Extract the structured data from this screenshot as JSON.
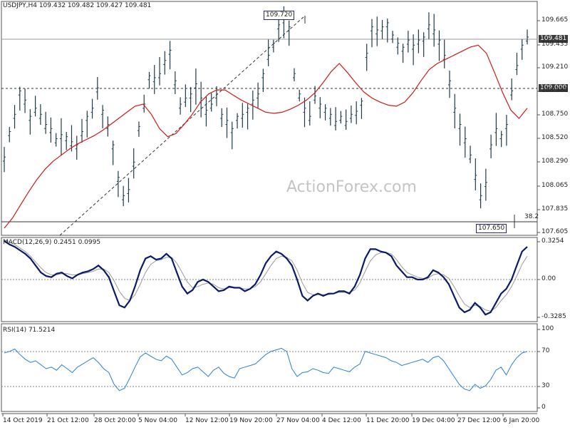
{
  "chart_data": [
    {
      "type": "candlestick",
      "title": "USDJPY,H4  109.432 109.482 109.427 109.481",
      "y_ticks": [
        "109.665",
        "109.435",
        "109.210",
        "108.980",
        "108.750",
        "108.520",
        "108.290",
        "108.065",
        "107.835",
        "107.605"
      ],
      "ylim": [
        107.55,
        109.85
      ],
      "x_ticks": [
        "14 Oct 2019",
        "21 Oct 12:00",
        "28 Oct 20:00",
        "5 Nov 04:00",
        "12 Nov 12:00",
        "19 Nov 20:00",
        "27 Nov 04:00",
        "4 Dec 12:00",
        "11 Dec 20:00",
        "19 Dec 04:00",
        "27 Dec 12:00",
        "6 Jan 20:00"
      ],
      "current_price": "109.481",
      "level_label": "109.000",
      "annotations": {
        "high": "109.720",
        "low": "107.650",
        "fib": "38.2"
      },
      "watermark": "ActionForex.com",
      "price_series": [
        108.3,
        108.55,
        108.72,
        108.95,
        108.86,
        108.7,
        108.78,
        108.72,
        108.62,
        108.58,
        108.48,
        108.52,
        108.5,
        108.45,
        108.42,
        108.55,
        108.7,
        108.78,
        108.98,
        108.76,
        108.62,
        108.42,
        108.1,
        107.92,
        107.98,
        108.25,
        108.6,
        108.82,
        109.1,
        109.08,
        109.12,
        109.25,
        109.35,
        109.05,
        108.82,
        108.88,
        108.92,
        109.02,
        108.88,
        108.76,
        108.82,
        108.92,
        108.72,
        108.66,
        108.58,
        108.7,
        108.72,
        108.78,
        108.86,
        108.92,
        109.12,
        109.3,
        109.42,
        109.6,
        109.66,
        109.58,
        109.12,
        108.92,
        108.78,
        108.7,
        108.9,
        108.82,
        108.78,
        108.72,
        108.65,
        108.7,
        108.65,
        108.72,
        108.75,
        108.85,
        109.32,
        109.58,
        109.55,
        109.58,
        109.62,
        109.5,
        109.42,
        109.38,
        109.45,
        109.4,
        109.45,
        109.48,
        109.6,
        109.55,
        109.45,
        109.3,
        109.05,
        108.78,
        108.62,
        108.48,
        108.32,
        108.12,
        107.92,
        108.05,
        108.42,
        108.58,
        108.52,
        108.62,
        108.95,
        109.2,
        109.4,
        109.48
      ],
      "ma_series": [
        107.62,
        107.72,
        107.85,
        107.98,
        108.1,
        108.2,
        108.28,
        108.34,
        108.4,
        108.45,
        108.49,
        108.53,
        108.58,
        108.64,
        108.7,
        108.76,
        108.82,
        108.84,
        108.74,
        108.6,
        108.52,
        108.55,
        108.64,
        108.74,
        108.86,
        108.94,
        108.98,
        108.98,
        108.93,
        108.88,
        108.84,
        108.8,
        108.76,
        108.75,
        108.76,
        108.79,
        108.83,
        108.88,
        108.95,
        109.05,
        109.16,
        109.24,
        109.15,
        109.05,
        108.96,
        108.9,
        108.86,
        108.83,
        108.82,
        108.86,
        108.95,
        109.07,
        109.18,
        109.24,
        109.28,
        109.32,
        109.36,
        109.4,
        109.42,
        109.34,
        109.15,
        108.95,
        108.78,
        108.7,
        108.8
      ],
      "legend": "none",
      "grid": false
    },
    {
      "type": "macd",
      "title": "MACD(12,26,9) 0.2451 0.0995",
      "y_ticks": [
        "0.3254",
        "0.00",
        "-0.3285"
      ],
      "ylim": [
        -0.36,
        0.36
      ],
      "macd_series": [
        0.33,
        0.3,
        0.28,
        0.25,
        0.22,
        0.18,
        0.12,
        0.06,
        0.03,
        0.02,
        0.05,
        0.06,
        0.03,
        0.01,
        0.04,
        0.06,
        0.07,
        0.09,
        0.12,
        0.08,
        0.02,
        -0.1,
        -0.22,
        -0.24,
        -0.18,
        -0.06,
        0.08,
        0.18,
        0.2,
        0.17,
        0.18,
        0.22,
        0.18,
        0.06,
        -0.06,
        -0.12,
        -0.09,
        -0.02,
        0.0,
        -0.02,
        -0.06,
        -0.1,
        -0.09,
        -0.06,
        -0.07,
        -0.07,
        -0.1,
        -0.08,
        -0.04,
        0.04,
        0.14,
        0.2,
        0.24,
        0.22,
        0.18,
        0.12,
        0.0,
        -0.14,
        -0.18,
        -0.14,
        -0.12,
        -0.14,
        -0.12,
        -0.12,
        -0.1,
        -0.1,
        -0.12,
        -0.06,
        0.04,
        0.18,
        0.26,
        0.26,
        0.24,
        0.23,
        0.2,
        0.12,
        0.07,
        0.02,
        0.02,
        0.0,
        0.0,
        0.02,
        0.08,
        0.06,
        0.02,
        -0.04,
        -0.14,
        -0.24,
        -0.28,
        -0.26,
        -0.2,
        -0.24,
        -0.3,
        -0.28,
        -0.2,
        -0.12,
        -0.08,
        0.0,
        0.12,
        0.24,
        0.28
      ],
      "signal_series": [
        0.34,
        0.32,
        0.3,
        0.27,
        0.24,
        0.2,
        0.15,
        0.1,
        0.06,
        0.04,
        0.04,
        0.05,
        0.05,
        0.04,
        0.04,
        0.05,
        0.06,
        0.07,
        0.09,
        0.09,
        0.06,
        -0.01,
        -0.1,
        -0.16,
        -0.18,
        -0.13,
        -0.04,
        0.06,
        0.13,
        0.16,
        0.17,
        0.19,
        0.19,
        0.14,
        0.06,
        -0.02,
        -0.07,
        -0.06,
        -0.04,
        -0.03,
        -0.04,
        -0.07,
        -0.08,
        -0.07,
        -0.07,
        -0.07,
        -0.08,
        -0.08,
        -0.06,
        -0.02,
        0.05,
        0.12,
        0.18,
        0.2,
        0.19,
        0.16,
        0.08,
        -0.03,
        -0.11,
        -0.13,
        -0.13,
        -0.13,
        -0.13,
        -0.12,
        -0.11,
        -0.11,
        -0.11,
        -0.09,
        -0.03,
        0.07,
        0.16,
        0.21,
        0.23,
        0.23,
        0.22,
        0.17,
        0.11,
        0.06,
        0.04,
        0.02,
        0.01,
        0.01,
        0.04,
        0.05,
        0.04,
        0.01,
        -0.06,
        -0.14,
        -0.21,
        -0.24,
        -0.22,
        -0.23,
        -0.26,
        -0.27,
        -0.24,
        -0.18,
        -0.13,
        -0.06,
        0.03,
        0.13,
        0.2
      ],
      "grid": false
    },
    {
      "type": "line",
      "title": "RSI(14) 71.5214",
      "y_ticks": [
        "100",
        "70",
        "30",
        "0"
      ],
      "ylim": [
        0,
        100
      ],
      "levels": [
        70,
        30
      ],
      "rsi_series": [
        70,
        72,
        75,
        68,
        62,
        58,
        60,
        55,
        50,
        52,
        48,
        55,
        50,
        45,
        52,
        56,
        60,
        64,
        58,
        50,
        45,
        30,
        22,
        25,
        38,
        52,
        65,
        70,
        66,
        62,
        60,
        66,
        62,
        52,
        42,
        45,
        50,
        52,
        46,
        40,
        48,
        52,
        44,
        40,
        38,
        50,
        52,
        54,
        56,
        62,
        68,
        72,
        74,
        76,
        72,
        50,
        40,
        45,
        46,
        50,
        48,
        45,
        44,
        52,
        50,
        48,
        46,
        52,
        56,
        72,
        70,
        68,
        66,
        64,
        60,
        58,
        54,
        56,
        58,
        60,
        62,
        58,
        64,
        66,
        60,
        50,
        40,
        30,
        24,
        22,
        30,
        25,
        28,
        36,
        48,
        52,
        42,
        55,
        64,
        70,
        72
      ],
      "grid": false
    }
  ]
}
